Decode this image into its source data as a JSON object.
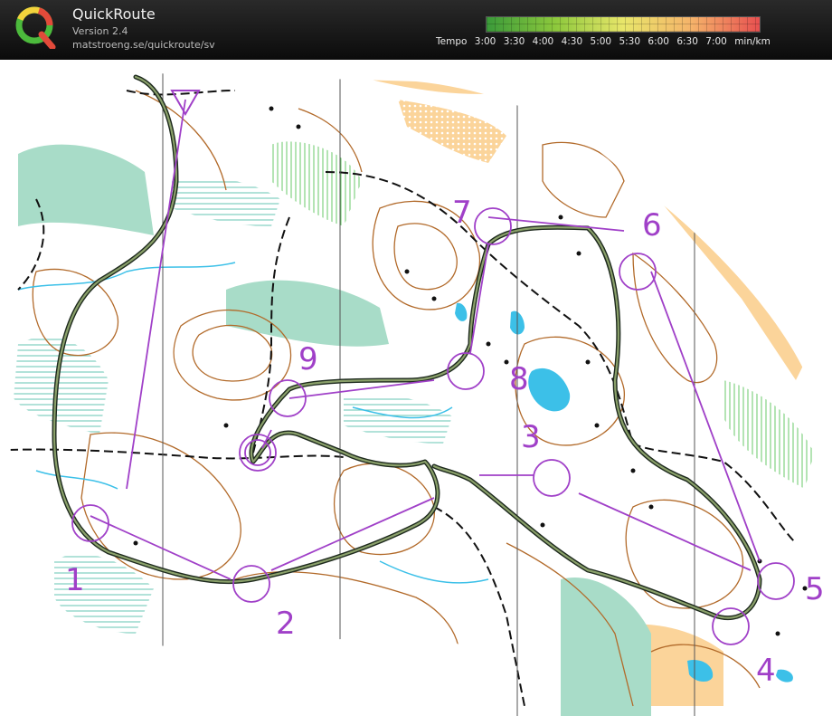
{
  "app": {
    "title": "QuickRoute",
    "version": "Version 2.4",
    "url": "matstroeng.se/quickroute/sv"
  },
  "legend": {
    "prefix": "Tempo",
    "labels": [
      "3:00",
      "3:30",
      "4:00",
      "4:30",
      "5:00",
      "5:30",
      "6:00",
      "6:30",
      "7:00"
    ],
    "unit": "min/km",
    "color_stops": [
      "#3a9a3a",
      "#8cc83c",
      "#e8e66a",
      "#f5b36a",
      "#e85050"
    ]
  },
  "map": {
    "course": [
      {
        "label": "1"
      },
      {
        "label": "2"
      },
      {
        "label": "3"
      },
      {
        "label": "4"
      },
      {
        "label": "5"
      },
      {
        "label": "6"
      },
      {
        "label": "7"
      },
      {
        "label": "8"
      },
      {
        "label": "9"
      }
    ],
    "colors": {
      "course": "#a040c8",
      "route": "#4a7a3a",
      "contour": "#b26a2a",
      "water": "#3cc0e8",
      "green": "#a8dcc8",
      "open": "#fbd49a"
    }
  }
}
